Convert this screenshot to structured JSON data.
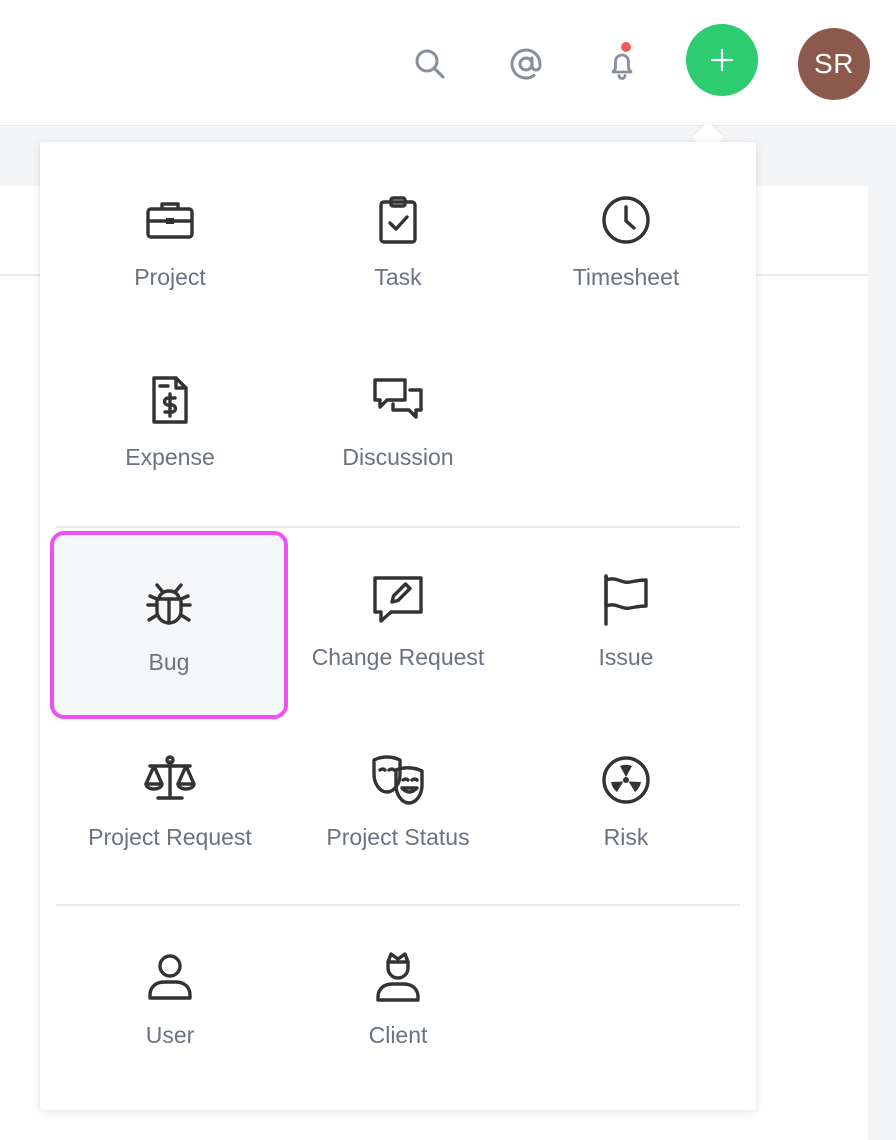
{
  "colors": {
    "accent": "#2ecc71",
    "notification_dot": "#f35b5b",
    "highlight": "#f04ff5"
  },
  "topbar": {
    "icons": [
      "search-icon",
      "mention-icon",
      "bell-icon"
    ],
    "avatar_initials": "SR"
  },
  "menu": {
    "sections": [
      {
        "items": [
          {
            "label": "Project",
            "icon": "briefcase-icon"
          },
          {
            "label": "Task",
            "icon": "clipboard-check-icon"
          },
          {
            "label": "Timesheet",
            "icon": "clock-icon"
          },
          {
            "label": "Expense",
            "icon": "dollar-file-icon"
          },
          {
            "label": "Discussion",
            "icon": "chat-bubbles-icon"
          }
        ]
      },
      {
        "items": [
          {
            "label": "Bug",
            "icon": "bug-icon",
            "highlighted": true
          },
          {
            "label": "Change Request",
            "icon": "edit-message-icon"
          },
          {
            "label": "Issue",
            "icon": "flag-icon"
          },
          {
            "label": "Project Request",
            "icon": "scales-icon"
          },
          {
            "label": "Project Status",
            "icon": "theater-masks-icon"
          },
          {
            "label": "Risk",
            "icon": "radiation-icon"
          }
        ]
      },
      {
        "items": [
          {
            "label": "User",
            "icon": "user-icon"
          },
          {
            "label": "Client",
            "icon": "crowned-user-icon"
          }
        ]
      }
    ]
  }
}
